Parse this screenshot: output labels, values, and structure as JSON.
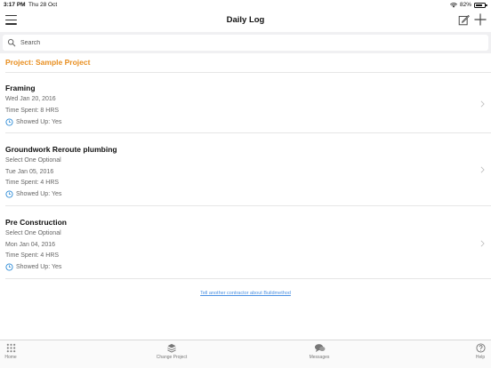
{
  "status_bar": {
    "time": "3:17 PM",
    "date": "Thu 28 Oct",
    "battery": "82%",
    "battery_level": 0.82
  },
  "nav": {
    "title": "Daily Log"
  },
  "search": {
    "placeholder": "Search"
  },
  "project": {
    "label": "Project: Sample Project"
  },
  "entries": [
    {
      "title": "Framing",
      "date": "Wed Jan 20, 2016",
      "time_spent": "Time Spent: 8 HRS",
      "showed_up": "Showed Up: Yes"
    },
    {
      "title": "Groundwork Reroute plumbing",
      "subtitle": "Select One Optional",
      "date": "Tue Jan 05, 2016",
      "time_spent": "Time Spent: 4 HRS",
      "showed_up": "Showed Up: Yes"
    },
    {
      "title": "Pre Construction",
      "subtitle": "Select One Optional",
      "date": "Mon Jan 04, 2016",
      "time_spent": "Time Spent: 4 HRS",
      "showed_up": "Showed Up: Yes"
    }
  ],
  "footer_link": "Tell another contractor about Buildmethod",
  "tabs": [
    {
      "label": "Home",
      "icon": "grid-icon"
    },
    {
      "label": "Change Project",
      "icon": "layers-icon"
    },
    {
      "label": "Messages",
      "icon": "chat-bubbles-icon"
    },
    {
      "label": "Help",
      "icon": "question-circle-icon"
    }
  ],
  "colors": {
    "accent": "#e88e1f",
    "link": "#4a90e2",
    "clock": "#2b8ad6"
  }
}
